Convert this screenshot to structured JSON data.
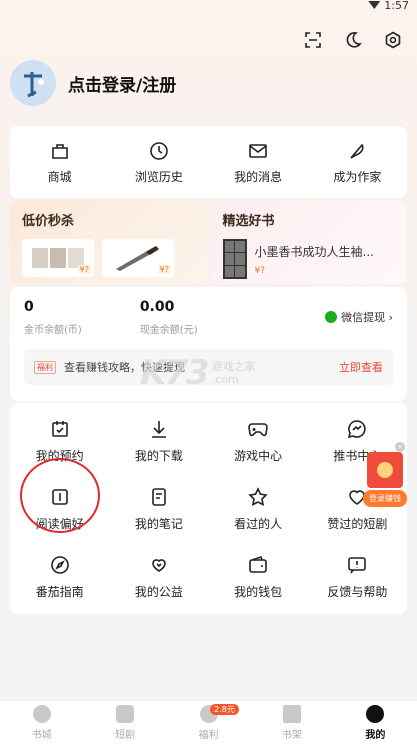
{
  "status": {
    "time": "1:57"
  },
  "profile": {
    "login_label": "点击登录/注册"
  },
  "quick_links": [
    {
      "label": "商城",
      "icon": "bag-icon"
    },
    {
      "label": "浏览历史",
      "icon": "clock-icon"
    },
    {
      "label": "我的消息",
      "icon": "mail-icon"
    },
    {
      "label": "成为作家",
      "icon": "feather-icon"
    }
  ],
  "promo": {
    "left_title": "低价秒杀",
    "left_price_1": "¥?",
    "left_price_2": "¥?",
    "right_title": "精选好书",
    "book_title": "小墨香书成功人生袖...",
    "book_price": "¥?"
  },
  "wallet": {
    "gold_value": "0",
    "gold_label": "金币余额(币)",
    "cash_value": "0.00",
    "cash_label": "现金余额(元)",
    "wechat_label": "微信提现 ›",
    "tip_tag": "福利",
    "tip_text": "查看赚钱攻略，快速提现",
    "tip_link": "立即查看"
  },
  "watermark": {
    "big": "K73",
    "line1": "游戏之家",
    "line2": ".com"
  },
  "grid": [
    {
      "label": "我的预约",
      "icon": "calendar-check-icon"
    },
    {
      "label": "我的下载",
      "icon": "download-icon"
    },
    {
      "label": "游戏中心",
      "icon": "gamepad-icon"
    },
    {
      "label": "推书中心",
      "icon": "chat-bubble-icon"
    },
    {
      "label": "阅读偏好",
      "icon": "book-open-icon"
    },
    {
      "label": "我的笔记",
      "icon": "note-icon"
    },
    {
      "label": "看过的人",
      "icon": "star-icon"
    },
    {
      "label": "赞过的短剧",
      "icon": "heart-icon"
    },
    {
      "label": "番茄指南",
      "icon": "compass-icon"
    },
    {
      "label": "我的公益",
      "icon": "hand-heart-icon"
    },
    {
      "label": "我的钱包",
      "icon": "wallet-icon"
    },
    {
      "label": "反馈与帮助",
      "icon": "feedback-icon"
    }
  ],
  "float_button": {
    "label": "登录赚钱",
    "close": "×"
  },
  "bottom_nav": [
    {
      "label": "书城"
    },
    {
      "label": "短剧"
    },
    {
      "label": "福利",
      "badge": "2.8元"
    },
    {
      "label": "书架"
    },
    {
      "label": "我的"
    }
  ],
  "colors": {
    "accent": "#e64a3a",
    "wechat": "#1aad19",
    "annotation": "#e02a2a"
  }
}
